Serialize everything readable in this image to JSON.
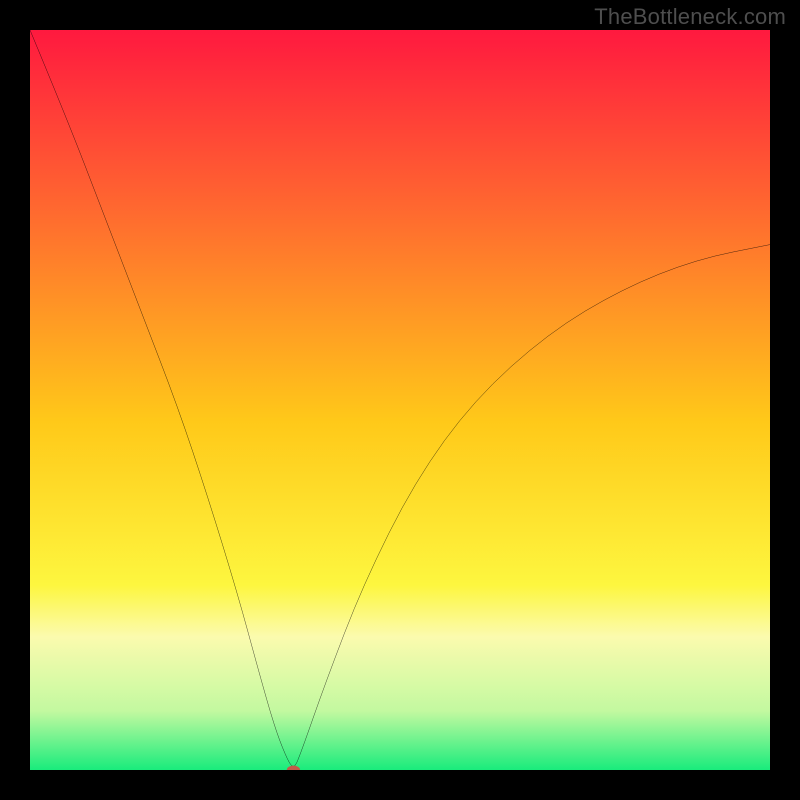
{
  "watermark": "TheBottleneck.com",
  "chart_data": {
    "type": "line",
    "title": "",
    "xlabel": "",
    "ylabel": "",
    "xlim": [
      0,
      100
    ],
    "ylim": [
      0,
      100
    ],
    "grid": false,
    "background_gradient": {
      "stops": [
        {
          "offset": 0.0,
          "color": "#ff193f"
        },
        {
          "offset": 0.25,
          "color": "#ff6b2f"
        },
        {
          "offset": 0.53,
          "color": "#ffc919"
        },
        {
          "offset": 0.75,
          "color": "#fdf63f"
        },
        {
          "offset": 0.82,
          "color": "#fbfbae"
        },
        {
          "offset": 0.92,
          "color": "#c3f9a0"
        },
        {
          "offset": 1.0,
          "color": "#19ec7c"
        }
      ]
    },
    "series": [
      {
        "name": "bottleneck-curve",
        "x": [
          0,
          5,
          10,
          15,
          20,
          24,
          28,
          31,
          33,
          34.5,
          35.6,
          36.5,
          40,
          45,
          52,
          60,
          70,
          80,
          90,
          100
        ],
        "y": [
          100,
          88,
          75,
          62,
          49,
          37,
          24,
          13,
          6,
          2,
          0,
          2,
          12,
          25,
          39,
          50,
          59,
          65,
          69,
          71
        ]
      }
    ],
    "marker": {
      "name": "minimum-point",
      "x": 35.6,
      "y": 0,
      "rx": 0.9,
      "ry": 0.6,
      "color": "#c25a4a"
    }
  }
}
